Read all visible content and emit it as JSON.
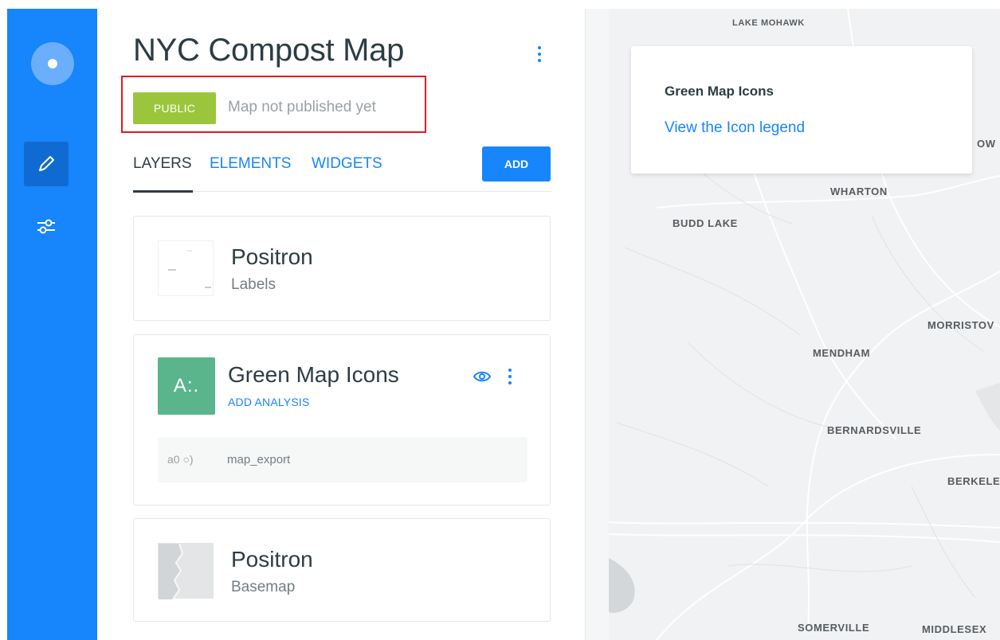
{
  "map_title": "NYC Compost Map",
  "privacy_badge": "PUBLIC",
  "publish_status": "Map not published yet",
  "tabs": {
    "layers": "LAYERS",
    "elements": "ELEMENTS",
    "widgets": "WIDGETS"
  },
  "add_button": "ADD",
  "layers": [
    {
      "name": "Positron",
      "subtitle": "Labels"
    },
    {
      "letter": "A:.",
      "name": "Green Map Icons",
      "action": "ADD ANALYSIS",
      "source_id": "a0 ○)",
      "source_name": "map_export"
    },
    {
      "name": "Positron",
      "subtitle": "Basemap"
    }
  ],
  "legend": {
    "title": "Green Map Icons",
    "link": "View the Icon legend"
  },
  "map_labels": {
    "top": "LAKE MOHAWK",
    "right_cut": "OW",
    "wharton": "WHARTON",
    "budd_lake": "BUDD LAKE",
    "morristown": "MORRISTOV",
    "mendham": "MENDHAM",
    "bernardsville": "BERNARDSVILLE",
    "berkeley": "BERKELE",
    "somerville": "SOMERVILLE",
    "middlesex": "MIDDLESEX"
  },
  "colors": {
    "accent": "#1785fb",
    "public_badge": "#9bc63b",
    "layer_tile": "#5ab58c",
    "highlight": "#e01b24"
  },
  "icons": [
    "carto-logo-icon",
    "pencil-icon",
    "sliders-icon",
    "kebab-icon",
    "eye-icon"
  ]
}
